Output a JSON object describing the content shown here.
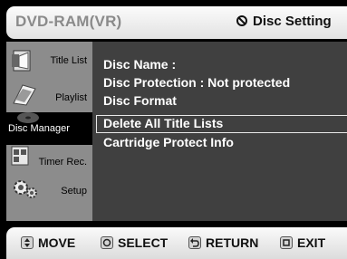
{
  "header": {
    "model": "DVD-RAM(VR)",
    "section": "Disc Setting",
    "section_icon": "disc-icon"
  },
  "sidebar": {
    "items": [
      {
        "label": "Title List",
        "icon": "title-list-icon"
      },
      {
        "label": "Playlist",
        "icon": "playlist-icon"
      },
      {
        "label": "Disc Manager",
        "icon": "disc-manager-icon",
        "active": true
      },
      {
        "label": "Timer Rec.",
        "icon": "timer-rec-icon"
      },
      {
        "label": "Setup",
        "icon": "setup-gear-icon"
      }
    ]
  },
  "menu": {
    "items": [
      {
        "label": "Disc Name        :"
      },
      {
        "label": "Disc Protection : Not protected"
      },
      {
        "label": "Disc Format"
      },
      {
        "label": "Delete All Title Lists",
        "selected": true
      },
      {
        "label": "Cartridge Protect Info"
      }
    ]
  },
  "footer": {
    "move": "MOVE",
    "select": "SELECT",
    "return": "RETURN",
    "exit": "EXIT"
  },
  "colors": {
    "main_bg": "#404040",
    "sidebar_bg": "#8c8c8c",
    "active_bg": "#000000",
    "text": "#ffffff"
  }
}
